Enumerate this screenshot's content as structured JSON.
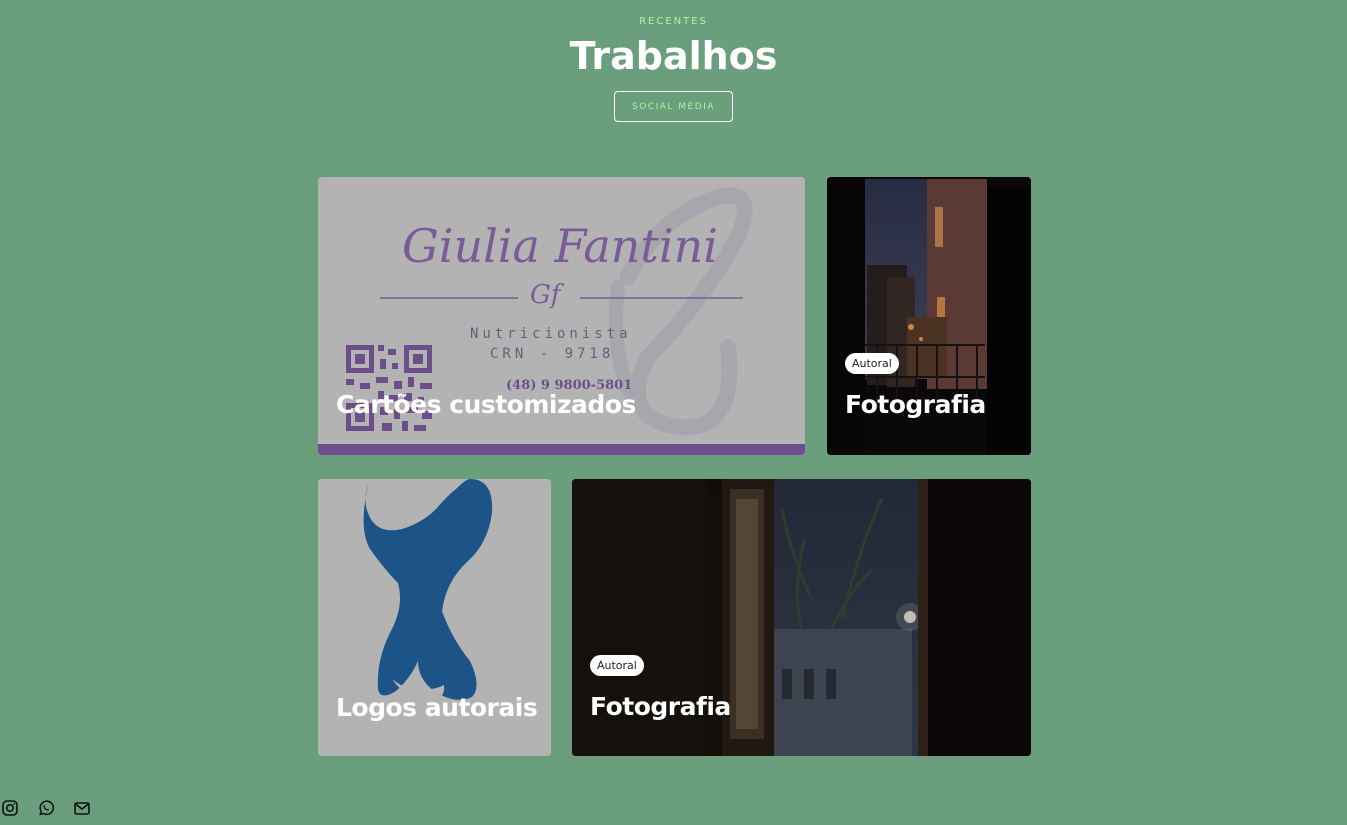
{
  "header": {
    "eyebrow": "RECENTES",
    "title": "Trabalhos",
    "filter_label": "SOCIAL MEDIA"
  },
  "cards": [
    {
      "title": "Cartões customizados",
      "card_text": {
        "name": "Giulia Fantini",
        "monogram": "Gf",
        "role": "Nutricionista",
        "crn": "CRN - 9718",
        "phone": "(48) 9 9800-5801"
      }
    },
    {
      "tag": "Autoral",
      "title": "Fotografia"
    },
    {
      "title": "Logos autorais"
    },
    {
      "tag": "Autoral",
      "title": "Fotografia"
    }
  ],
  "social": [
    {
      "icon": "instagram-icon"
    },
    {
      "icon": "whatsapp-icon"
    },
    {
      "icon": "mail-icon"
    }
  ],
  "colors": {
    "background": "#6b9e7d",
    "accent": "#b6f09c",
    "card_purple": "#6c4f8a",
    "logo_blue": "#1d5487",
    "card_grey": "#b3b3b3"
  }
}
